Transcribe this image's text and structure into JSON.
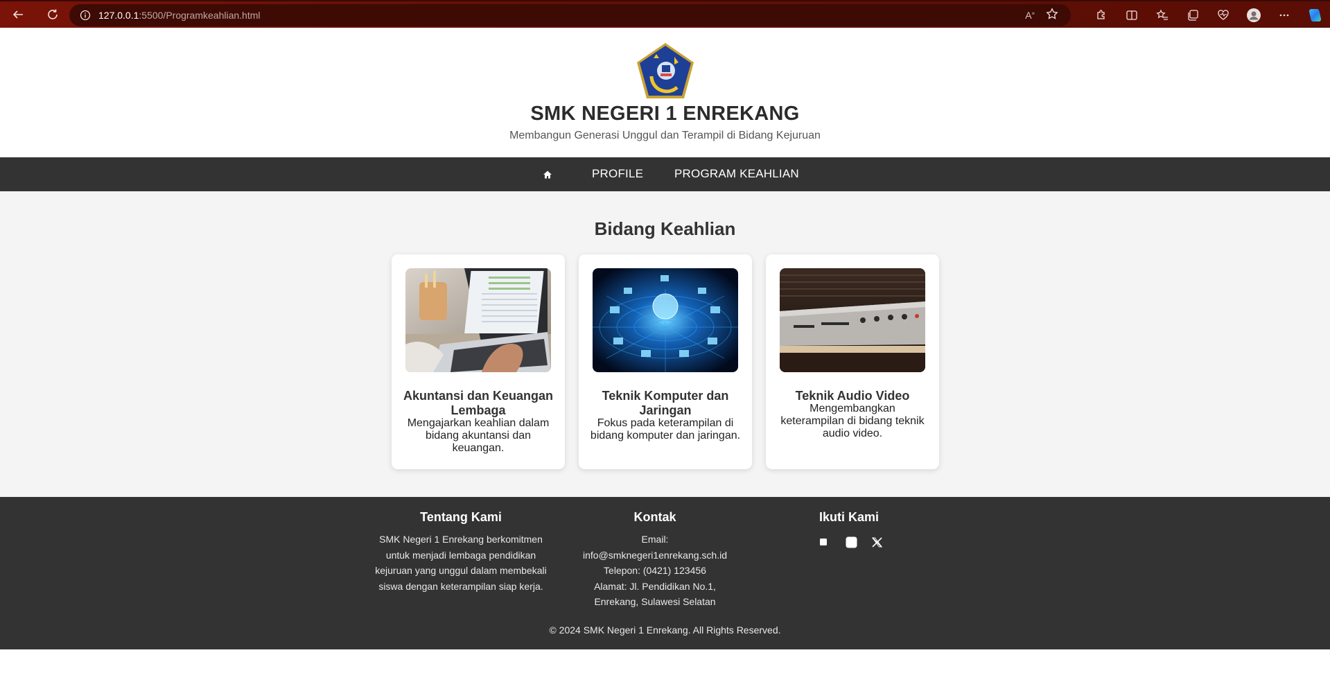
{
  "browser": {
    "url_host": "127.0.0.1",
    "url_rest": ":5500/Programkeahlian.html"
  },
  "header": {
    "title": "SMK NEGERI 1 ENREKANG",
    "tagline": "Membangun Generasi Unggul dan Terampil di Bidang Kejuruan"
  },
  "nav": {
    "home_icon": "home-icon",
    "items": [
      "PROFILE",
      "PROGRAM KEAHLIAN"
    ]
  },
  "main": {
    "section_title": "Bidang Keahlian",
    "cards": [
      {
        "title": "Akuntansi dan Keuangan Lembaga",
        "description": "Mengajarkan keahlian dalam bidang akuntansi dan keuangan."
      },
      {
        "title": "Teknik Komputer dan Jaringan",
        "description": "Fokus pada keterampilan di bidang komputer dan jaringan."
      },
      {
        "title": "Teknik Audio Video",
        "description": "Mengembangkan keterampilan di bidang teknik audio video."
      }
    ]
  },
  "footer": {
    "about": {
      "heading": "Tentang Kami",
      "text": "SMK Negeri 1 Enrekang berkomitmen untuk menjadi lembaga pendidikan kejuruan yang unggul dalam membekali siswa dengan keterampilan siap kerja."
    },
    "contact": {
      "heading": "Kontak",
      "email_label": "Email:",
      "email": "info@smknegeri1enrekang.sch.id",
      "phone": "Telepon: (0421) 123456",
      "address": "Alamat: Jl. Pendidikan No.1, Enrekang, Sulawesi Selatan"
    },
    "follow": {
      "heading": "Ikuti Kami",
      "icons": [
        "facebook-icon",
        "instagram-icon",
        "x-twitter-icon"
      ]
    },
    "copyright": "© 2024 SMK Negeri 1 Enrekang. All Rights Reserved."
  },
  "colors": {
    "browser_bar": "#611006",
    "nav_bg": "#333333",
    "footer_bg": "#333333",
    "main_bg": "#f4f4f4"
  }
}
